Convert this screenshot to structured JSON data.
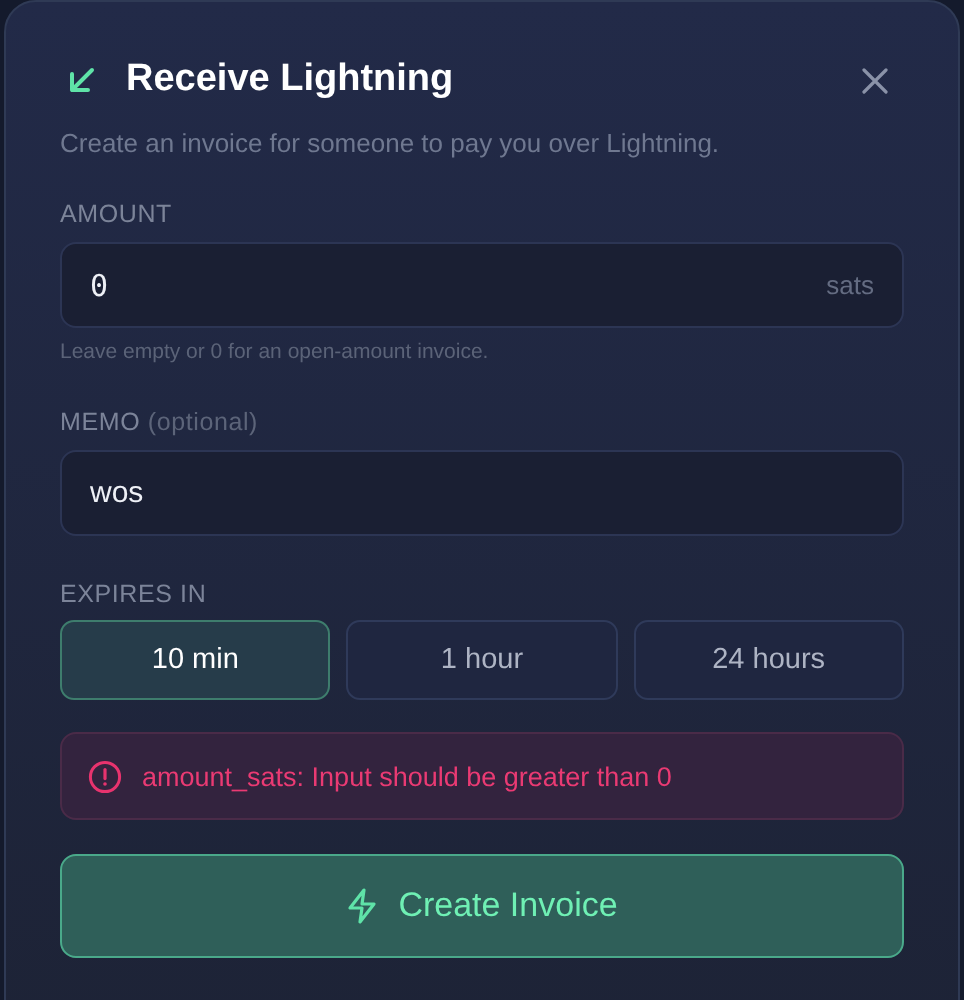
{
  "dialog": {
    "title": "Receive Lightning",
    "subtitle": "Create an invoice for someone to pay you over Lightning."
  },
  "amount": {
    "label": "AMOUNT",
    "value": "0",
    "unit": "sats",
    "hint": "Leave empty or 0 for an open-amount invoice."
  },
  "memo": {
    "label": "MEMO",
    "label_note": "(optional)",
    "value": "wos"
  },
  "expires": {
    "label": "EXPIRES IN",
    "options": [
      {
        "label": "10 min",
        "selected": true
      },
      {
        "label": "1 hour",
        "selected": false
      },
      {
        "label": "24 hours",
        "selected": false
      }
    ]
  },
  "error": {
    "message": "amount_sats: Input should be greater than 0"
  },
  "submit": {
    "label": "Create Invoice"
  }
}
